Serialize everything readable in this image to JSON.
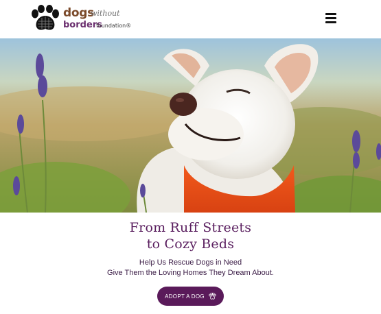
{
  "brand": {
    "name_line1": "dogs",
    "name_line1b": "without",
    "name_line2": "borders",
    "name_line2b": "foundation®",
    "logo_icon": "paw-print-icon",
    "colors": {
      "brown": "#7b4a2a",
      "purple": "#6a2e6e"
    }
  },
  "header": {
    "menu_icon": "hamburger-menu-icon"
  },
  "hero": {
    "image": "white-dog-with-orange-bandana-in-lavender-field"
  },
  "content": {
    "headline_line1": "From Ruff Streets",
    "headline_line2": "to Cozy Beds",
    "subtext_line1": "Help Us Rescue Dogs in Need",
    "subtext_line2": "Give Them the Loving Homes They Dream About.",
    "cta_label": "ADOPT A DOG",
    "cta_icon": "paw-icon"
  },
  "colors": {
    "accent": "#5a1a5a",
    "headline": "#5a1f5f"
  }
}
